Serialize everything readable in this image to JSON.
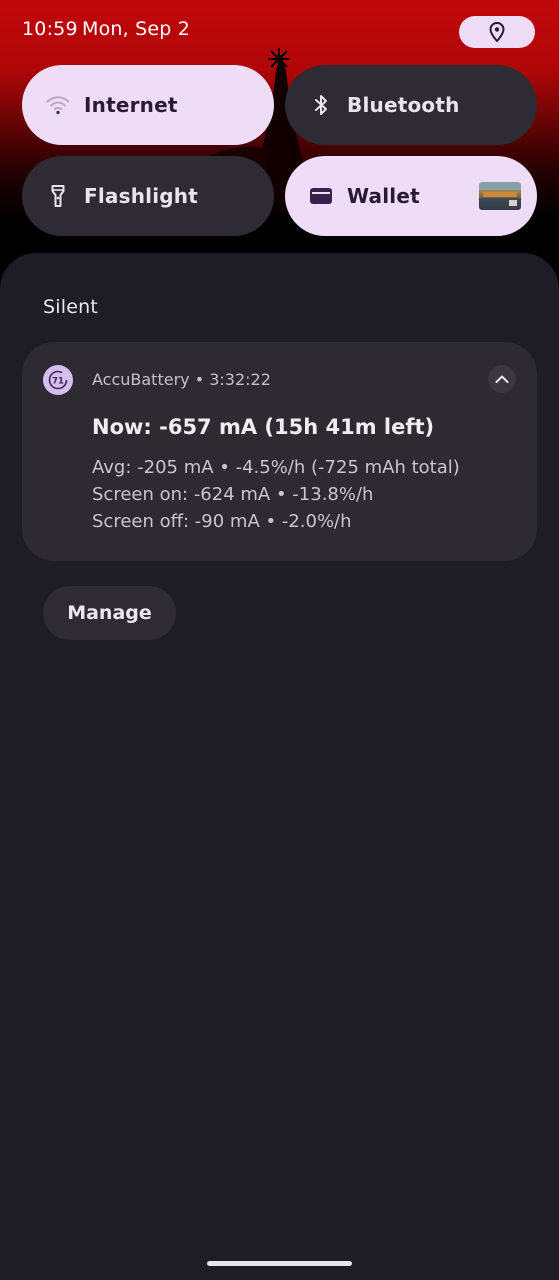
{
  "status_bar": {
    "time": "10:59",
    "date": "Mon, Sep 2",
    "location_icon": "location-pin-icon"
  },
  "quick_settings": {
    "tiles": [
      {
        "label": "Internet",
        "icon": "wifi-icon",
        "state": "on"
      },
      {
        "label": "Bluetooth",
        "icon": "bluetooth-icon",
        "state": "off"
      },
      {
        "label": "Flashlight",
        "icon": "flashlight-icon",
        "state": "off"
      },
      {
        "label": "Wallet",
        "icon": "wallet-icon",
        "state": "on"
      }
    ]
  },
  "notifications": {
    "section_header": "Silent",
    "items": [
      {
        "app_name": "AccuBattery",
        "app_icon_text": "71",
        "timestamp": "3:32:22",
        "title": "Now: -657 mA (15h 41m left)",
        "lines": [
          "Avg: -205 mA • -4.5%/h (-725 mAh total)",
          "Screen on: -624 mA • -13.8%/h",
          "Screen off: -90 mA • -2.0%/h"
        ]
      }
    ],
    "manage_label": "Manage"
  },
  "colors": {
    "tile_on": "#efdcf6",
    "tile_off": "#2f2b35",
    "shade_background": "#1e1c24",
    "card_background": "#2d2a32",
    "wallpaper_red": "#c0080a"
  }
}
